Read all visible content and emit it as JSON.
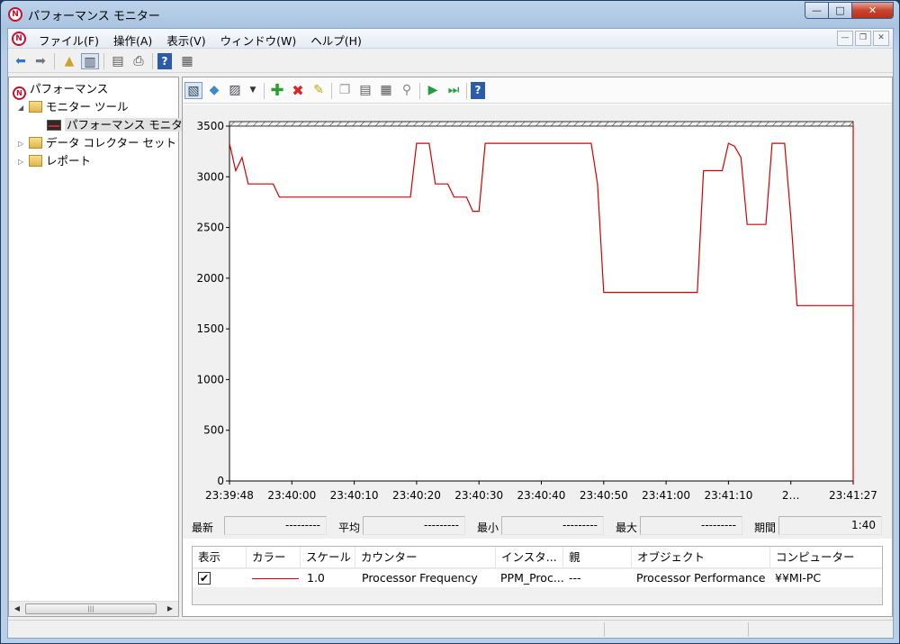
{
  "window": {
    "title": "パフォーマンス モニター",
    "app_icon": "perfmon-icon"
  },
  "titlebar_buttons": {
    "minimize": "—",
    "maximize": "□",
    "close": "✕"
  },
  "menubar": {
    "items": [
      "ファイル(F)",
      "操作(A)",
      "表示(V)",
      "ウィンドウ(W)",
      "ヘルプ(H)"
    ],
    "mdi": {
      "minimize": "—",
      "restore": "❐",
      "close": "✕"
    }
  },
  "tree": {
    "root": "パフォーマンス",
    "monitor_tools": "モニター ツール",
    "perf_monitor": "パフォーマンス モニター",
    "data_collector_sets": "データ コレクター セット",
    "reports": "レポート"
  },
  "chart_data": {
    "type": "line",
    "ylim": [
      0,
      3500
    ],
    "yticks": [
      "3500",
      "3000",
      "2500",
      "2000",
      "1500",
      "1000",
      "500",
      "0"
    ],
    "x_tick_labels": [
      "23:39:48",
      "23:40:00",
      "23:40:10",
      "23:40:20",
      "23:40:30",
      "23:40:40",
      "23:40:50",
      "23:41:00",
      "23:41:10",
      "2…",
      "23:41:27"
    ],
    "series": [
      {
        "color": "#d40000",
        "points": [
          [
            0,
            3330
          ],
          [
            1,
            3060
          ],
          [
            2,
            3190
          ],
          [
            3,
            2930
          ],
          [
            4,
            2930
          ],
          [
            5,
            2930
          ],
          [
            6,
            2930
          ],
          [
            7,
            2930
          ],
          [
            8,
            2800
          ],
          [
            9,
            2800
          ],
          [
            10,
            2800
          ],
          [
            11,
            2800
          ],
          [
            12,
            2800
          ],
          [
            13,
            2800
          ],
          [
            14,
            2800
          ],
          [
            15,
            2800
          ],
          [
            16,
            2800
          ],
          [
            17,
            2800
          ],
          [
            18,
            2800
          ],
          [
            19,
            2800
          ],
          [
            20,
            2800
          ],
          [
            21,
            2800
          ],
          [
            22,
            2800
          ],
          [
            23,
            2800
          ],
          [
            24,
            2800
          ],
          [
            25,
            2800
          ],
          [
            26,
            2800
          ],
          [
            27,
            2800
          ],
          [
            28,
            2800
          ],
          [
            29,
            2800
          ],
          [
            30,
            3330
          ],
          [
            31,
            3330
          ],
          [
            32,
            3330
          ],
          [
            33,
            2930
          ],
          [
            34,
            2930
          ],
          [
            35,
            2930
          ],
          [
            36,
            2800
          ],
          [
            37,
            2800
          ],
          [
            38,
            2800
          ],
          [
            39,
            2660
          ],
          [
            40,
            2660
          ],
          [
            41,
            3330
          ],
          [
            42,
            3330
          ],
          [
            43,
            3330
          ],
          [
            44,
            3330
          ],
          [
            45,
            3330
          ],
          [
            46,
            3330
          ],
          [
            47,
            3330
          ],
          [
            48,
            3330
          ],
          [
            49,
            3330
          ],
          [
            50,
            3330
          ],
          [
            51,
            3330
          ],
          [
            52,
            3330
          ],
          [
            53,
            3330
          ],
          [
            54,
            3330
          ],
          [
            55,
            3330
          ],
          [
            56,
            3330
          ],
          [
            57,
            3330
          ],
          [
            58,
            3330
          ],
          [
            59,
            2930
          ],
          [
            60,
            1860
          ],
          [
            61,
            1860
          ],
          [
            62,
            1860
          ],
          [
            63,
            1860
          ],
          [
            64,
            1860
          ],
          [
            65,
            1860
          ],
          [
            66,
            1860
          ],
          [
            67,
            1860
          ],
          [
            68,
            1860
          ],
          [
            69,
            1860
          ],
          [
            70,
            1860
          ],
          [
            71,
            1860
          ],
          [
            72,
            1860
          ],
          [
            73,
            1860
          ],
          [
            74,
            1860
          ],
          [
            75,
            1860
          ],
          [
            76,
            3060
          ],
          [
            77,
            3060
          ],
          [
            78,
            3060
          ],
          [
            79,
            3060
          ],
          [
            80,
            3330
          ],
          [
            81,
            3300
          ],
          [
            82,
            3190
          ],
          [
            83,
            2530
          ],
          [
            84,
            2530
          ],
          [
            85,
            2530
          ],
          [
            86,
            2530
          ],
          [
            87,
            3330
          ],
          [
            88,
            3330
          ],
          [
            89,
            3330
          ],
          [
            90,
            2600
          ],
          [
            91,
            1730
          ],
          [
            92,
            1730
          ],
          [
            93,
            1730
          ],
          [
            94,
            1730
          ],
          [
            95,
            1730
          ],
          [
            96,
            1730
          ],
          [
            97,
            1730
          ],
          [
            98,
            1730
          ],
          [
            99,
            1730
          ],
          [
            100,
            1730
          ]
        ]
      }
    ]
  },
  "stats": {
    "last_label": "最新",
    "last_value": "---------",
    "avg_label": "平均",
    "avg_value": "---------",
    "min_label": "最小",
    "min_value": "---------",
    "max_label": "最大",
    "max_value": "---------",
    "duration_label": "期間",
    "duration_value": "1:40"
  },
  "legend": {
    "headers": [
      "表示",
      "カラー",
      "スケール",
      "カウンター",
      "インスタ...",
      "親",
      "オブジェクト",
      "コンピューター"
    ],
    "rows": [
      {
        "checked": "✔",
        "color": "#e00000",
        "scale": "1.0",
        "counter": "Processor Frequency",
        "instance": "PPM_Proc...",
        "parent": "---",
        "object": "Processor Performance",
        "computer": "¥¥MI-PC"
      }
    ]
  }
}
